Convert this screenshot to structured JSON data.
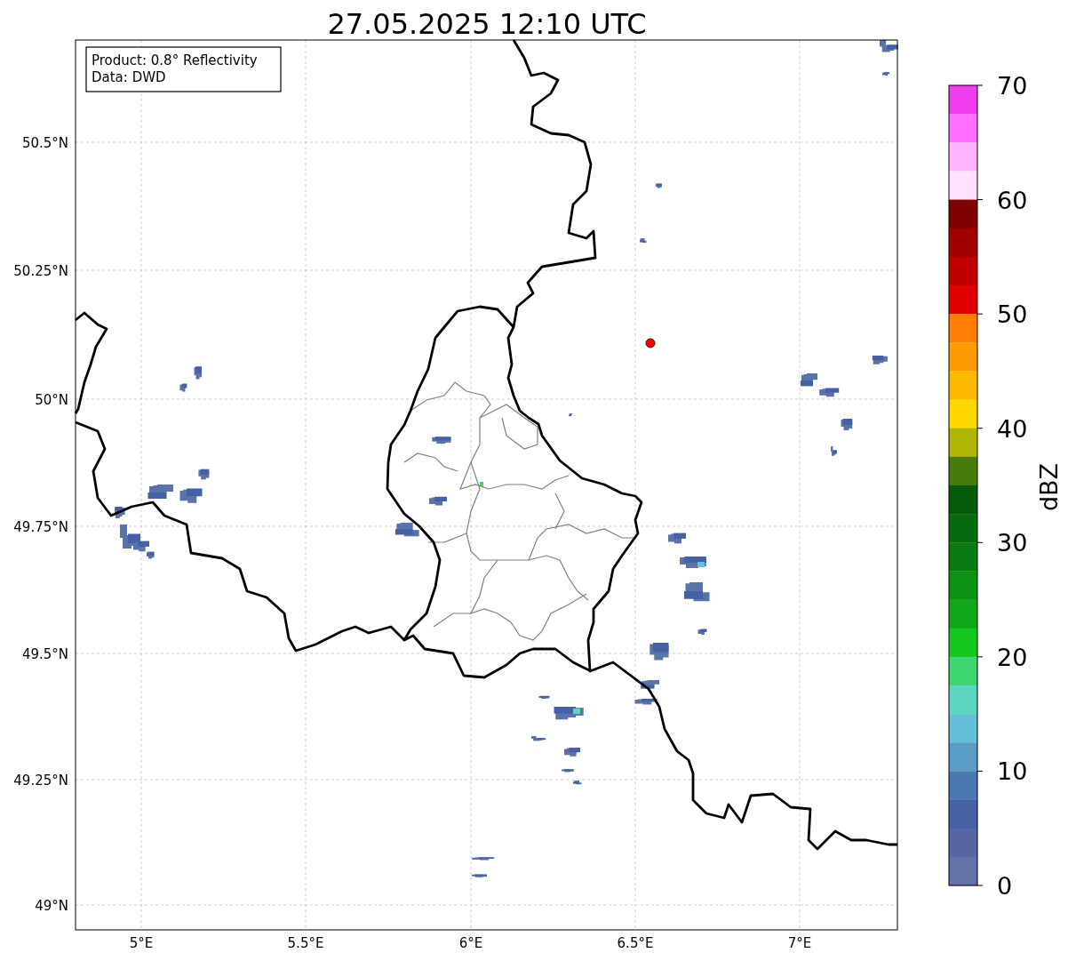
{
  "title": "27.05.2025 12:10 UTC",
  "info_box": [
    "Product: 0.8° Reflectivity",
    "Data: DWD"
  ],
  "map": {
    "lat_labels": [
      "50.5°N",
      "50.25°N",
      "50°N",
      "49.75°N",
      "49.5°N",
      "49.25°N",
      "49°N"
    ],
    "lon_labels": [
      "5°E",
      "5.5°E",
      "6°E",
      "6.5°E",
      "7°E"
    ]
  },
  "colorbar": {
    "label": "dBZ",
    "ticks": [
      "70",
      "60",
      "50",
      "40",
      "30",
      "20",
      "10",
      "0"
    ],
    "bands": [
      {
        "color": "#ee3cee"
      },
      {
        "color": "#ff6eff"
      },
      {
        "color": "#ffb4ff"
      },
      {
        "color": "#ffe0ff"
      },
      {
        "color": "#800000"
      },
      {
        "color": "#a00000"
      },
      {
        "color": "#c00000"
      },
      {
        "color": "#e00000"
      },
      {
        "color": "#ff7d00"
      },
      {
        "color": "#ff9a00"
      },
      {
        "color": "#ffb800"
      },
      {
        "color": "#ffd800"
      },
      {
        "color": "#b0b404"
      },
      {
        "color": "#467a0a"
      },
      {
        "color": "#065a0c"
      },
      {
        "color": "#086a0e"
      },
      {
        "color": "#0a7b10"
      },
      {
        "color": "#0b9212"
      },
      {
        "color": "#0ea818"
      },
      {
        "color": "#12c81c"
      },
      {
        "color": "#3dd670"
      },
      {
        "color": "#5dd6c0"
      },
      {
        "color": "#63c0d8"
      },
      {
        "color": "#5a9ec8"
      },
      {
        "color": "#4a78b0"
      },
      {
        "color": "#4660a4"
      },
      {
        "color": "#5566a0"
      },
      {
        "color": "#6473a8"
      }
    ]
  }
}
